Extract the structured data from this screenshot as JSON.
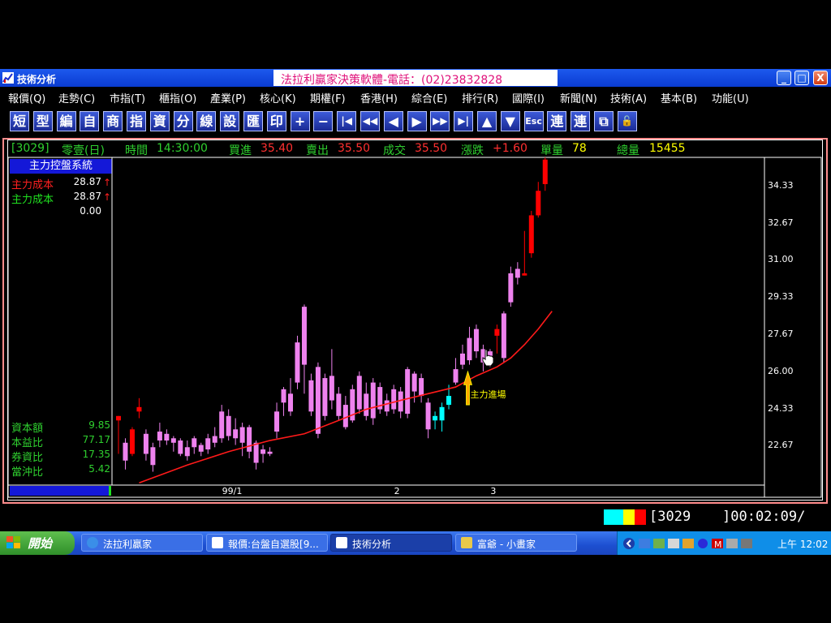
{
  "window": {
    "title": "技術分析",
    "banner": "法拉利贏家決策軟體-電話：(02)23832828",
    "min_label": "_",
    "max_label": "□",
    "close_label": "X"
  },
  "menu": [
    {
      "label": "報價(Q)",
      "x": 10
    },
    {
      "label": "走勢(C)",
      "x": 72
    },
    {
      "label": "市指(T)",
      "x": 135
    },
    {
      "label": "櫃指(O)",
      "x": 196
    },
    {
      "label": "產業(P)",
      "x": 259
    },
    {
      "label": "核心(K)",
      "x": 320
    },
    {
      "label": "期權(F)",
      "x": 382
    },
    {
      "label": "香港(H)",
      "x": 444
    },
    {
      "label": "綜合(E)",
      "x": 507
    },
    {
      "label": "排行(R)",
      "x": 569
    },
    {
      "label": "國際(I)",
      "x": 631
    },
    {
      "label": "新聞(N)",
      "x": 690
    },
    {
      "label": "技術(A)",
      "x": 752
    },
    {
      "label": "基本(B)",
      "x": 814
    },
    {
      "label": "功能(U)",
      "x": 877
    }
  ],
  "toolbar": [
    {
      "label": "短",
      "name": "short-button"
    },
    {
      "label": "型",
      "name": "type-button"
    },
    {
      "label": "編",
      "name": "edit-button"
    },
    {
      "label": "自",
      "name": "custom-button"
    },
    {
      "label": "商",
      "name": "product-button"
    },
    {
      "label": "指",
      "name": "index-button"
    },
    {
      "label": "資",
      "name": "data-button"
    },
    {
      "label": "分",
      "name": "minute-button"
    },
    {
      "label": "線",
      "name": "line-button"
    },
    {
      "label": "設",
      "name": "settings-button"
    },
    {
      "label": "匯",
      "name": "export-button"
    },
    {
      "label": "印",
      "name": "print-button"
    },
    {
      "label": "+",
      "name": "zoom-in-button"
    },
    {
      "label": "−",
      "name": "zoom-out-button"
    },
    {
      "label": "|◀",
      "name": "first-button"
    },
    {
      "label": "◀◀",
      "name": "fast-back-button"
    },
    {
      "label": "◀",
      "name": "back-button"
    },
    {
      "label": "▶",
      "name": "forward-button"
    },
    {
      "label": "▶▶",
      "name": "fast-forward-button"
    },
    {
      "label": "▶|",
      "name": "last-button"
    },
    {
      "label": "▲",
      "name": "up-button"
    },
    {
      "label": "▼",
      "name": "down-button"
    },
    {
      "label": "Esc",
      "name": "esc-button"
    },
    {
      "label": "連",
      "name": "link-button-1"
    },
    {
      "label": "連",
      "name": "link-button-2"
    },
    {
      "label": "⧉",
      "name": "window-button"
    },
    {
      "label": "🔓",
      "name": "lock-button"
    }
  ],
  "quote": {
    "code": "[3029]",
    "name": "零壹(日)",
    "time_label": "時間",
    "time": "14:30:00",
    "bid_label": "買進",
    "bid": "35.40",
    "ask_label": "賣出",
    "ask": "35.50",
    "deal_label": "成交",
    "deal": "35.50",
    "change_label": "漲跌",
    "change": "+1.60",
    "vol_label": "單量",
    "vol": "78",
    "total_label": "總量",
    "total": "15455"
  },
  "panel": {
    "title": "主力控盤系統",
    "rows": [
      {
        "label": "主力成本",
        "value": "28.87",
        "arrow": "↑",
        "color": "#ff2020"
      },
      {
        "label": "主力成本",
        "value": "28.87",
        "arrow": "↑",
        "color": "#20e020"
      },
      {
        "label": "",
        "value": "0.00",
        "arrow": "",
        "color": "#ffffff"
      }
    ],
    "stats": [
      {
        "label": "資本額",
        "value": "9.85"
      },
      {
        "label": "本益比",
        "value": "77.17"
      },
      {
        "label": "券資比",
        "value": "17.35"
      },
      {
        "label": "當沖比",
        "value": "5.42"
      }
    ]
  },
  "chart_data": {
    "type": "candlestick",
    "ylim": [
      20.9,
      35.6
    ],
    "yticks": [
      "34.33",
      "32.67",
      "31.00",
      "29.33",
      "27.67",
      "26.00",
      "24.33",
      "22.67"
    ],
    "xticks": [
      {
        "label": "99/1",
        "index": 16
      },
      {
        "label": "2",
        "index": 41
      },
      {
        "label": "3",
        "index": 55
      }
    ],
    "annotation": "主力進場",
    "annotation_index": 51,
    "colors": {
      "up": "#ff0000",
      "down": "#ee82ee",
      "entry": "#00ffff",
      "ma": "#ff1a1a"
    },
    "candles": [
      [
        24.0,
        23.8,
        24.0,
        22.3,
        "up"
      ],
      [
        22.8,
        22.0,
        23.0,
        21.6,
        "down"
      ],
      [
        23.4,
        22.3,
        23.5,
        22.2,
        "up"
      ],
      [
        24.4,
        24.2,
        24.8,
        23.9,
        "up"
      ],
      [
        23.2,
        22.3,
        23.4,
        22.0,
        "down"
      ],
      [
        22.6,
        21.8,
        22.8,
        21.5,
        "down"
      ],
      [
        23.3,
        22.9,
        23.7,
        22.6,
        "down"
      ],
      [
        23.2,
        22.9,
        23.4,
        22.7,
        "down"
      ],
      [
        23.0,
        22.8,
        23.1,
        22.4,
        "down"
      ],
      [
        22.9,
        22.3,
        23.0,
        22.2,
        "down"
      ],
      [
        22.6,
        22.2,
        22.9,
        22.0,
        "down"
      ],
      [
        23.0,
        22.6,
        23.1,
        22.3,
        "down"
      ],
      [
        22.7,
        22.4,
        22.8,
        22.2,
        "down"
      ],
      [
        23.0,
        22.5,
        23.2,
        22.3,
        "down"
      ],
      [
        23.1,
        22.8,
        23.5,
        22.6,
        "down"
      ],
      [
        24.2,
        23.0,
        24.5,
        22.8,
        "down"
      ],
      [
        24.0,
        23.1,
        24.3,
        22.9,
        "down"
      ],
      [
        23.4,
        23.0,
        23.9,
        22.7,
        "down"
      ],
      [
        23.5,
        22.8,
        23.7,
        22.2,
        "down"
      ],
      [
        23.5,
        22.4,
        23.6,
        22.1,
        "down"
      ],
      [
        22.8,
        21.9,
        22.9,
        21.6,
        "down"
      ],
      [
        22.5,
        22.3,
        22.7,
        21.9,
        "down"
      ],
      [
        22.4,
        22.3,
        22.6,
        22.2,
        "down"
      ],
      [
        24.2,
        23.3,
        24.6,
        23.0,
        "down"
      ],
      [
        25.2,
        24.6,
        25.3,
        24.0,
        "down"
      ],
      [
        25.0,
        24.2,
        25.7,
        24.0,
        "down"
      ],
      [
        27.3,
        25.5,
        27.6,
        25.2,
        "down"
      ],
      [
        28.9,
        26.3,
        29.0,
        25.0,
        "down"
      ],
      [
        25.6,
        24.2,
        25.9,
        24.0,
        "down"
      ],
      [
        26.2,
        23.2,
        26.4,
        23.0,
        "down"
      ],
      [
        25.7,
        24.0,
        25.9,
        23.8,
        "down"
      ],
      [
        25.8,
        24.7,
        27.0,
        24.3,
        "down"
      ],
      [
        25.0,
        24.0,
        25.3,
        23.8,
        "down"
      ],
      [
        24.5,
        23.5,
        24.9,
        23.4,
        "down"
      ],
      [
        25.2,
        23.8,
        25.4,
        23.7,
        "down"
      ],
      [
        25.8,
        24.3,
        26.0,
        24.1,
        "down"
      ],
      [
        25.0,
        24.0,
        25.5,
        23.8,
        "down"
      ],
      [
        25.5,
        23.9,
        25.7,
        23.6,
        "down"
      ],
      [
        25.3,
        24.3,
        25.5,
        24.1,
        "down"
      ],
      [
        24.7,
        24.2,
        25.0,
        24.0,
        "down"
      ],
      [
        25.2,
        24.3,
        25.4,
        24.1,
        "down"
      ],
      [
        25.1,
        24.2,
        25.3,
        23.9,
        "down"
      ],
      [
        26.1,
        24.1,
        26.2,
        23.9,
        "down"
      ],
      [
        25.9,
        25.1,
        26.0,
        24.6,
        "down"
      ],
      [
        25.7,
        24.9,
        25.9,
        24.6,
        "down"
      ],
      [
        24.6,
        23.4,
        24.8,
        23.0,
        "down"
      ],
      [
        24.0,
        23.8,
        24.2,
        23.4,
        "entry"
      ],
      [
        24.4,
        23.8,
        24.6,
        23.3,
        "entry"
      ],
      [
        24.9,
        24.5,
        25.4,
        24.3,
        "entry"
      ],
      [
        26.1,
        25.5,
        26.6,
        25.4,
        "down"
      ],
      [
        26.8,
        26.3,
        27.2,
        26.1,
        "down"
      ],
      [
        27.5,
        26.5,
        28.0,
        26.3,
        "down"
      ],
      [
        27.9,
        26.9,
        28.1,
        26.6,
        "down"
      ],
      [
        27.0,
        26.4,
        27.2,
        26.0,
        "down"
      ],
      [
        26.9,
        26.6,
        27.0,
        26.2,
        "down"
      ],
      [
        27.9,
        27.6,
        28.1,
        26.8,
        "up"
      ],
      [
        28.6,
        26.6,
        28.7,
        26.4,
        "down"
      ],
      [
        30.4,
        29.1,
        30.7,
        28.9,
        "down"
      ],
      [
        30.6,
        30.2,
        30.9,
        29.9,
        "down"
      ],
      [
        30.4,
        30.3,
        32.3,
        30.3,
        "up"
      ],
      [
        33.0,
        31.3,
        33.2,
        31.1,
        "up"
      ],
      [
        34.1,
        33.0,
        34.5,
        32.9,
        "up"
      ],
      [
        35.5,
        34.4,
        35.6,
        34.1,
        "up"
      ]
    ],
    "ma": [
      [
        3,
        21.0
      ],
      [
        10,
        21.8
      ],
      [
        16,
        22.4
      ],
      [
        22,
        22.9
      ],
      [
        27,
        23.2
      ],
      [
        32,
        23.8
      ],
      [
        36,
        24.3
      ],
      [
        41,
        24.7
      ],
      [
        45,
        25.0
      ],
      [
        49,
        25.3
      ],
      [
        52,
        25.8
      ],
      [
        55,
        26.2
      ],
      [
        57,
        26.6
      ],
      [
        59,
        27.2
      ],
      [
        61,
        27.9
      ],
      [
        63,
        28.7
      ]
    ]
  },
  "status": {
    "code": "[3029",
    "clock": "]00:02:09/",
    "colors": [
      "#00ffff",
      "#ffff00",
      "#ff0000"
    ]
  },
  "taskbar": {
    "start": "開始",
    "tasks": [
      {
        "label": "法拉利贏家",
        "icon": "globe-icon"
      },
      {
        "label": "報價:台盤自選股[9...",
        "icon": "chart-icon"
      },
      {
        "label": "技術分析",
        "icon": "chart-icon"
      },
      {
        "label": "富爺 - 小畫家",
        "icon": "paint-icon"
      }
    ],
    "time": "上午 12:02"
  }
}
